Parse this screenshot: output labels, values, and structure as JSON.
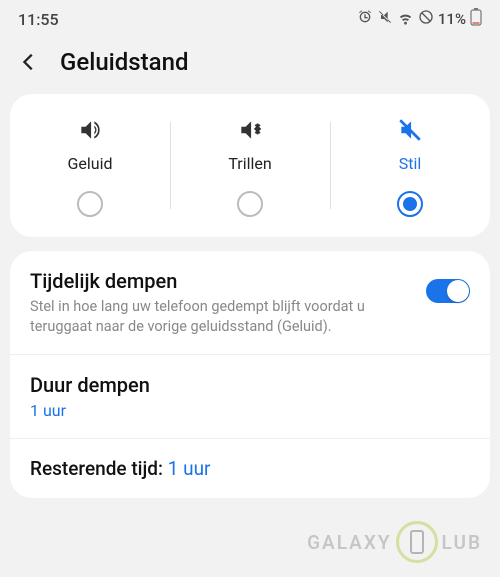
{
  "status": {
    "time": "11:55",
    "battery_pct": "11%"
  },
  "header": {
    "title": "Geluidstand"
  },
  "modes": [
    {
      "label": "Geluid",
      "selected": false,
      "icon": "volume"
    },
    {
      "label": "Trillen",
      "selected": false,
      "icon": "vibrate"
    },
    {
      "label": "Stil",
      "selected": true,
      "icon": "mute"
    }
  ],
  "temp_mute": {
    "title": "Tijdelijk dempen",
    "subtitle": "Stel in hoe lang uw telefoon gedempt blijft voordat u teruggaat naar de vorige geluidsstand (Geluid).",
    "enabled": true
  },
  "duration": {
    "title": "Duur dempen",
    "value": "1 uur"
  },
  "remaining": {
    "label": "Resterende tijd:",
    "value": "1 uur"
  },
  "watermark": {
    "left": "GALAXY",
    "right": "LUB"
  },
  "colors": {
    "accent": "#1a73e8"
  }
}
